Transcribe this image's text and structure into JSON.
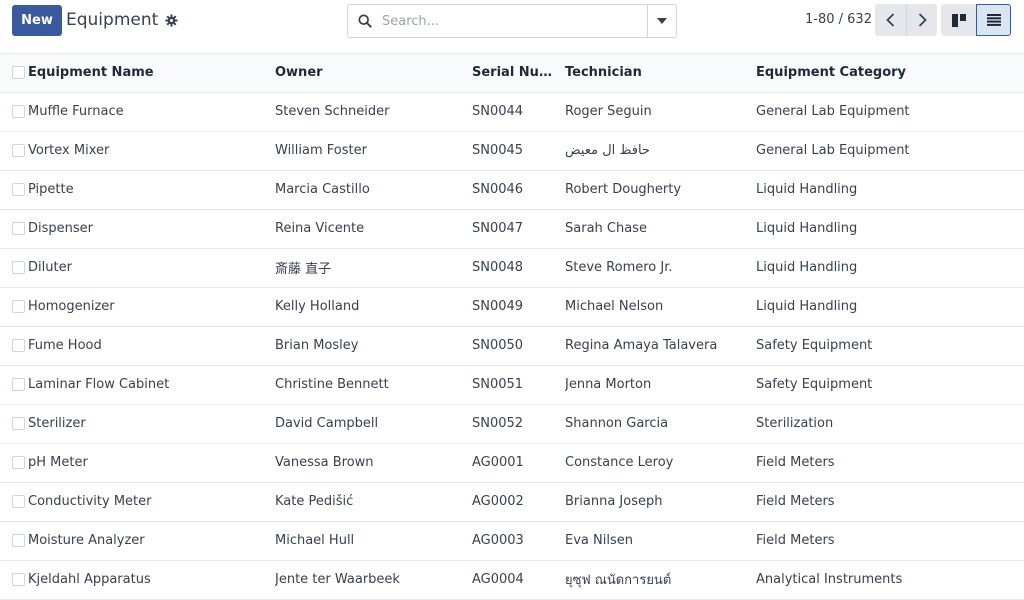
{
  "toolbar": {
    "new_label": "New",
    "title": "Equipment"
  },
  "search": {
    "placeholder": "Search..."
  },
  "pager": {
    "value": "1-80 / 632"
  },
  "table": {
    "columns": [
      "Equipment Name",
      "Owner",
      "Serial Num…",
      "Technician",
      "Equipment Category"
    ],
    "rows": [
      {
        "name": "Muffle Furnace",
        "owner": "Steven Schneider",
        "serial": "SN0044",
        "technician": "Roger Seguin",
        "category": "General Lab Equipment"
      },
      {
        "name": "Vortex Mixer",
        "owner": "William Foster",
        "serial": "SN0045",
        "technician": "حافظ ال معيض",
        "category": "General Lab Equipment"
      },
      {
        "name": "Pipette",
        "owner": "Marcia Castillo",
        "serial": "SN0046",
        "technician": "Robert Dougherty",
        "category": "Liquid Handling"
      },
      {
        "name": "Dispenser",
        "owner": "Reina Vicente",
        "serial": "SN0047",
        "technician": "Sarah Chase",
        "category": "Liquid Handling"
      },
      {
        "name": "Diluter",
        "owner": "斎藤 直子",
        "serial": "SN0048",
        "technician": "Steve Romero Jr.",
        "category": "Liquid Handling"
      },
      {
        "name": "Homogenizer",
        "owner": "Kelly Holland",
        "serial": "SN0049",
        "technician": "Michael Nelson",
        "category": "Liquid Handling"
      },
      {
        "name": "Fume Hood",
        "owner": "Brian Mosley",
        "serial": "SN0050",
        "technician": "Regina Amaya Talavera",
        "category": "Safety Equipment"
      },
      {
        "name": "Laminar Flow Cabinet",
        "owner": "Christine Bennett",
        "serial": "SN0051",
        "technician": "Jenna Morton",
        "category": "Safety Equipment"
      },
      {
        "name": "Sterilizer",
        "owner": "David Campbell",
        "serial": "SN0052",
        "technician": "Shannon Garcia",
        "category": "Sterilization"
      },
      {
        "name": "pH Meter",
        "owner": "Vanessa Brown",
        "serial": "AG0001",
        "technician": "Constance Leroy",
        "category": "Field Meters"
      },
      {
        "name": "Conductivity Meter",
        "owner": "Kate Pedišić",
        "serial": "AG0002",
        "technician": "Brianna Joseph",
        "category": "Field Meters"
      },
      {
        "name": "Moisture Analyzer",
        "owner": "Michael Hull",
        "serial": "AG0003",
        "technician": "Eva Nilsen",
        "category": "Field Meters"
      },
      {
        "name": "Kjeldahl Apparatus",
        "owner": "Jente ter Waarbeek",
        "serial": "AG0004",
        "technician": "ยุซุฟ ณนัดการยนต์",
        "category": "Analytical Instruments"
      }
    ]
  },
  "icons": {
    "settings": "gear-icon",
    "search": "search-icon",
    "search_toggle": "caret-down-icon",
    "pager_prev": "chevron-left-icon",
    "pager_next": "chevron-right-icon",
    "kanban_view": "kanban-icon",
    "list_view": "list-icon"
  },
  "colors": {
    "primary": "#3b5a9e",
    "active_view_bg": "#dbe4f3"
  }
}
